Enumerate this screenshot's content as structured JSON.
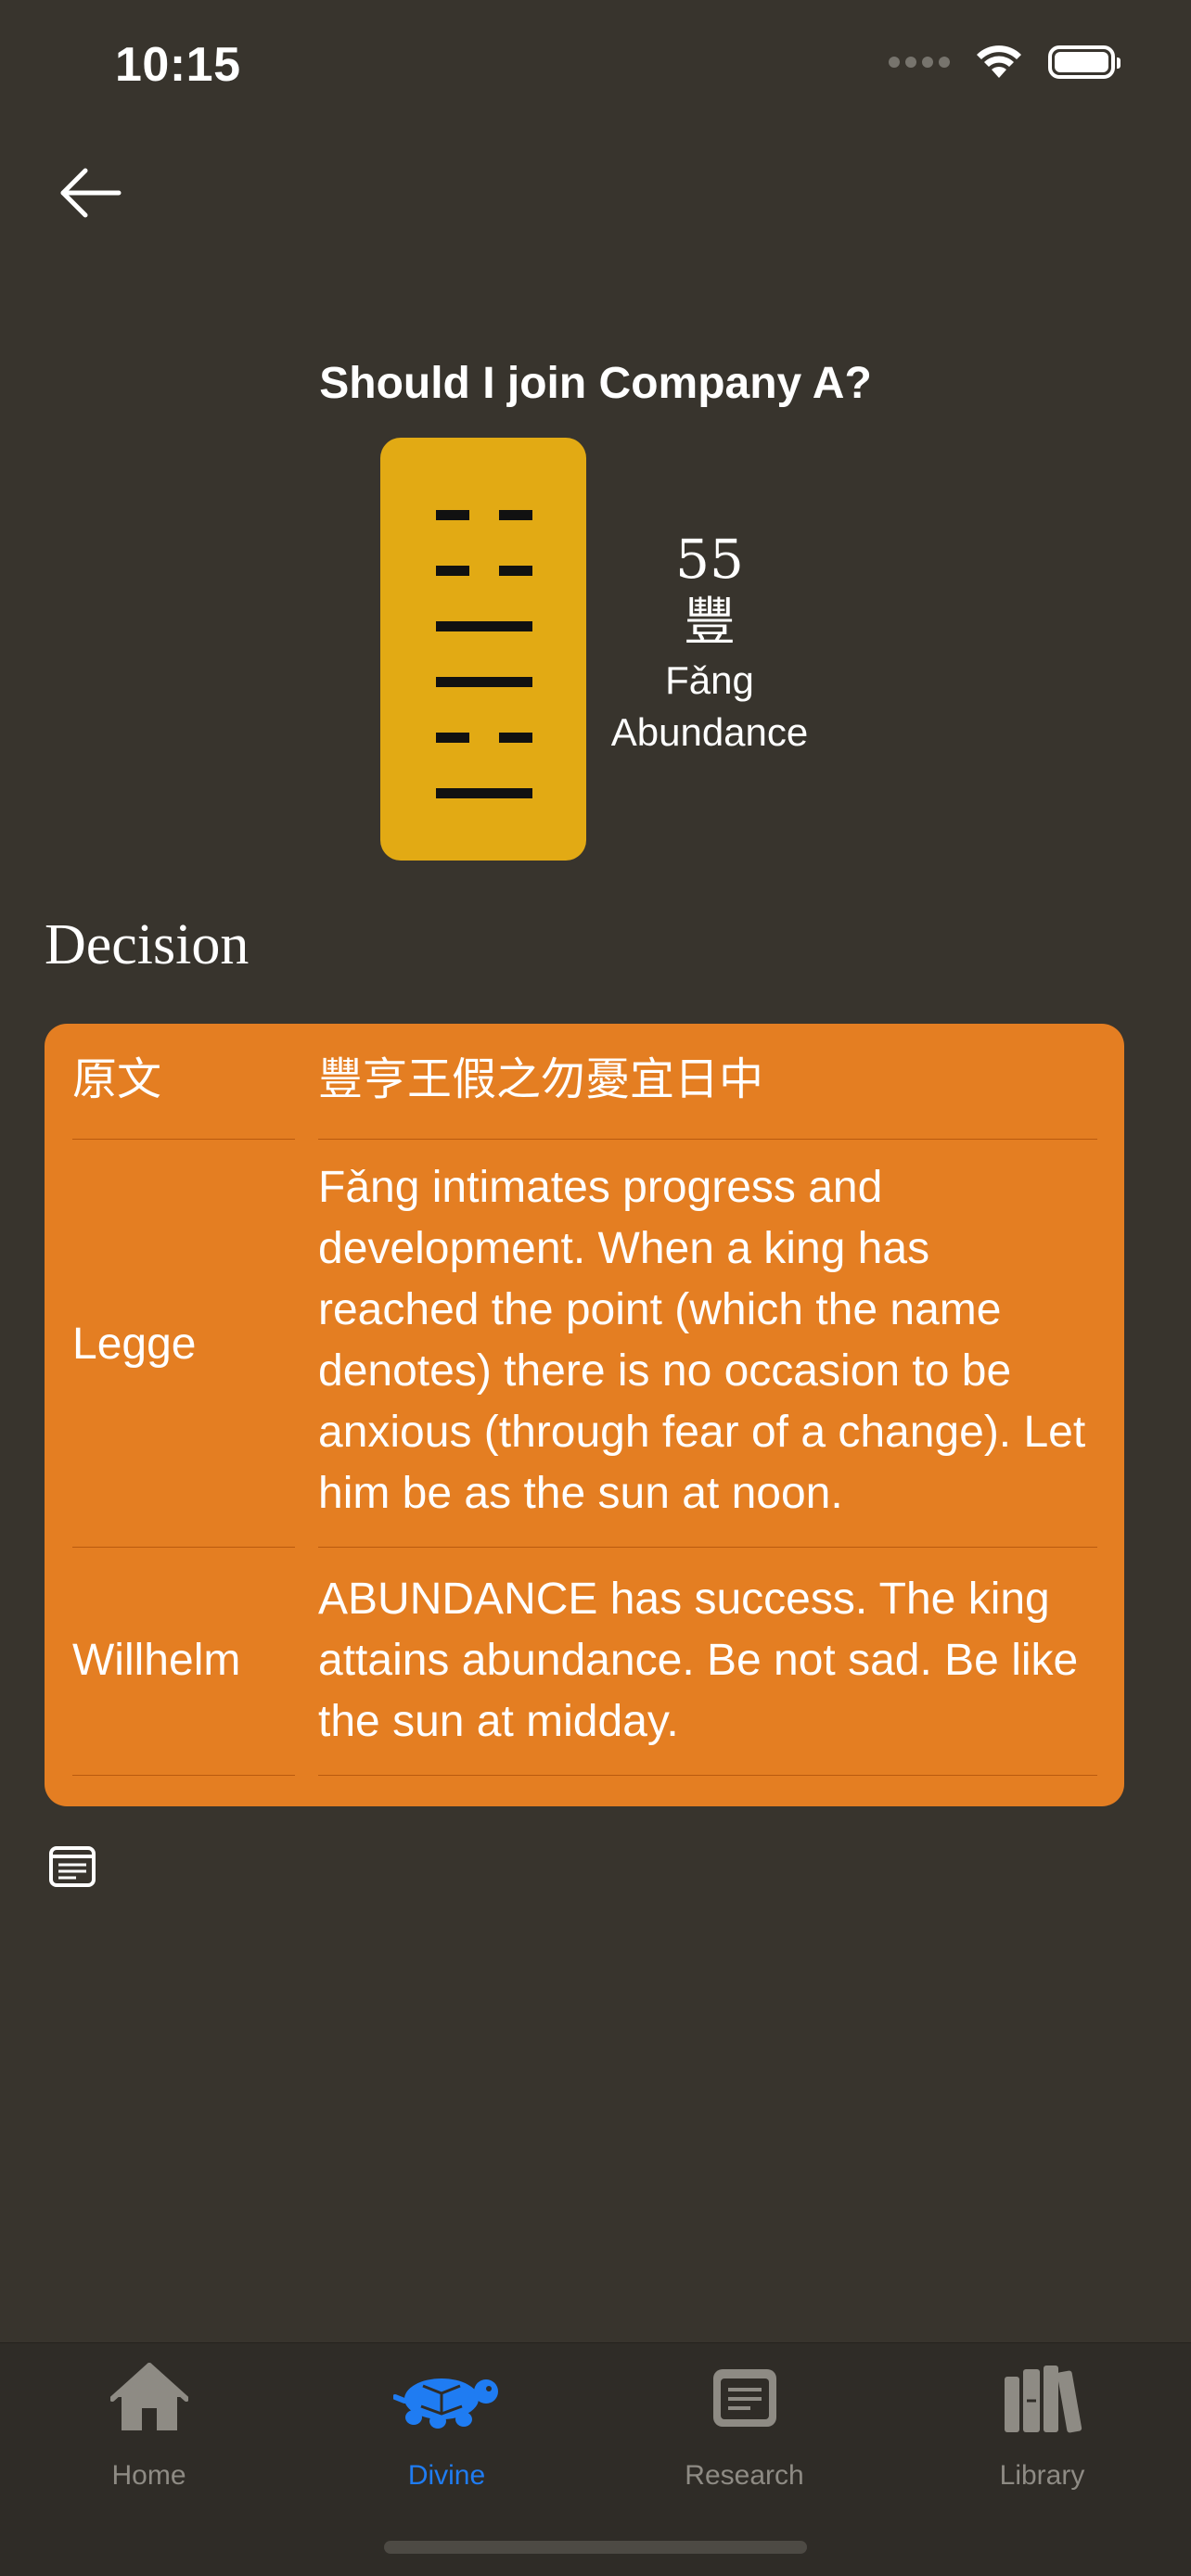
{
  "status_bar": {
    "time": "10:15"
  },
  "nav": {
    "back_icon": "arrow-left-icon"
  },
  "question": "Should I join Company A?",
  "hexagram": {
    "number": "55",
    "character": "豐",
    "pinyin": "Fǎng",
    "english": "Abundance",
    "lines_top_to_bottom": [
      "broken",
      "broken",
      "solid",
      "solid",
      "broken",
      "solid"
    ],
    "card_color": "#e2aa14"
  },
  "decision": {
    "title": "Decision",
    "card_color": "#e47e22",
    "rows": [
      {
        "label": "原文",
        "text": "豐亨王假之勿憂宜日中"
      },
      {
        "label": "Legge",
        "text": "Fǎng intimates progress and development. When a king has reached the point (which the name denotes) there is no occasion to be anxious (through fear of a change). Let him be as the sun at noon."
      },
      {
        "label": "Willhelm",
        "text": "ABUNDANCE has success. The king attains abundance. Be not sad. Be like the sun at midday."
      }
    ],
    "notes_icon": "notes-icon"
  },
  "tab_bar": {
    "active_color": "#1f7cf2",
    "inactive_color": "#8e8b84",
    "tabs": [
      {
        "label": "Home",
        "icon": "home-icon",
        "active": false
      },
      {
        "label": "Divine",
        "icon": "turtle-icon",
        "active": true
      },
      {
        "label": "Research",
        "icon": "newspaper-icon",
        "active": false
      },
      {
        "label": "Library",
        "icon": "books-icon",
        "active": false
      }
    ]
  }
}
